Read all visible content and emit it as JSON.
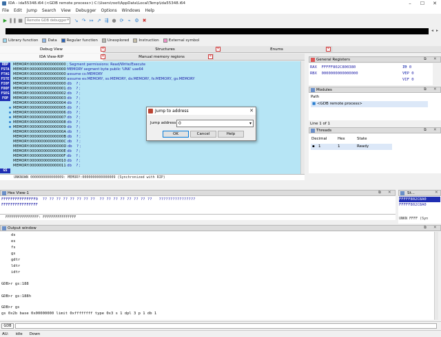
{
  "window": {
    "title": "IDA - ida55348.i64 (<GDB remote process>) C:\\Users\\root\\AppData\\Local\\Temp\\ida55348.i64",
    "min": "–",
    "max": "☐",
    "close": "✕"
  },
  "menu": [
    "File",
    "Edit",
    "Jump",
    "Search",
    "View",
    "Debugger",
    "Options",
    "Windows",
    "Help"
  ],
  "toolbar": {
    "debugger_select": "Remote GDB debugger"
  },
  "legend": [
    {
      "label": "Library function",
      "color": "#9ad8f0"
    },
    {
      "label": "Data",
      "color": "#8fb8e8"
    },
    {
      "label": "Regular function",
      "color": "#2a63b8"
    },
    {
      "label": "Unexplored",
      "color": "#b8b8b0"
    },
    {
      "label": "Instruction",
      "color": "#c8c0a8"
    },
    {
      "label": "External symbol",
      "color": "#f090c8"
    }
  ],
  "tabs": {
    "debug_view": "Debug View",
    "structures": "Structures",
    "enums": "Enums",
    "ida_view": "IDA View-RIP",
    "memory_regions": "Manual memory regions"
  },
  "registers_tags": [
    "RBP",
    "FSTA",
    "FTAG",
    "FSTE",
    "FIOF",
    "FOOF",
    "FSEG",
    "FOP"
  ],
  "code_lines": [
    {
      "addr": "MEMORY:0000000000000000",
      "text": " ; Segment permissions: Read/Write/Execute"
    },
    {
      "addr": "MEMORY:0000000000000000",
      "text": " MEMORY segment byte public 'UNK' use64"
    },
    {
      "addr": "MEMORY:0000000000000000",
      "text": " assume cs:MEMORY"
    },
    {
      "addr": "MEMORY:0000000000000000",
      "text": " assume es:MEMORY, ss:MEMORY, ds:MEMORY, fs:MEMORY, gs:MEMORY"
    },
    {
      "addr": "MEMORY:0000000000000000",
      "text": " db    ? ;"
    },
    {
      "addr": "MEMORY:0000000000000001",
      "text": " db    ? ;"
    },
    {
      "addr": "MEMORY:0000000000000002",
      "text": " db    ? ;"
    },
    {
      "addr": "MEMORY:0000000000000003",
      "text": " db    ? ;"
    },
    {
      "addr": "MEMORY:0000000000000004",
      "text": " db    ? ;"
    },
    {
      "addr": "MEMORY:0000000000000005",
      "text": " db    ? ;"
    },
    {
      "addr": "MEMORY:0000000000000006",
      "text": " db    ? ;"
    },
    {
      "addr": "MEMORY:0000000000000007",
      "text": " db    ? ;"
    },
    {
      "addr": "MEMORY:0000000000000008",
      "text": " db    ? ;"
    },
    {
      "addr": "MEMORY:0000000000000009",
      "text": " db    ? ;"
    },
    {
      "addr": "MEMORY:000000000000000A",
      "text": " db    ? ;"
    },
    {
      "addr": "MEMORY:000000000000000B",
      "text": " db    ? ;"
    },
    {
      "addr": "MEMORY:000000000000000C",
      "text": " db    ? ;"
    },
    {
      "addr": "MEMORY:000000000000000D",
      "text": " db    ? ;"
    },
    {
      "addr": "MEMORY:000000000000000E",
      "text": " db    ? ;"
    },
    {
      "addr": "MEMORY:000000000000000F",
      "text": " db    ? ;"
    },
    {
      "addr": "MEMORY:0000000000000010",
      "text": " db    ? ;"
    },
    {
      "addr": "MEMORY:0000000000000011",
      "text": " db    ? ;"
    }
  ],
  "gs_tag": "GS",
  "code_status": "UNKNOWN 0000000000000009: MEMORY:0000000000000009 (Synchronized with RIP)",
  "gen_regs": {
    "title": "General Registers",
    "rows": [
      {
        "name": "RAX",
        "value": "FFFFF802C800380"
      },
      {
        "name": "RBX",
        "value": "0000000000000000"
      }
    ],
    "flags": [
      "ID 0",
      "VIP 0",
      "VIF 0"
    ]
  },
  "modules": {
    "title": "Modules",
    "col": "Path",
    "row": "<GDB remote process>",
    "status": "Line 1 of 1"
  },
  "threads": {
    "title": "Threads",
    "cols": [
      "Decimal",
      "Hex",
      "State"
    ],
    "row": {
      "decimal": "1",
      "hex": "1",
      "state": "Ready"
    }
  },
  "hex_view": {
    "title": "Hex View-1",
    "line1_addr": "FFFFFFFFFFFFFFF0",
    "line1_bytes": "  ?? ?? ?? ?? ?? ?? ?? ??  ?? ?? ?? ?? ?? ?? ?? ??",
    "line1_ascii": "????????????????",
    "line2_addr": "FFFFFFFFFFFFFFFF",
    "status": "FFFFFFFFFFFFFFFF: FFFFFFFFFFFFFFFF"
  },
  "stack_view": {
    "title": "St...",
    "line1": "FFFFF802C8A0",
    "line2": "FFFFF802C8A0",
    "status": "UNKN FFFF (Syn"
  },
  "output": {
    "title": "Output window",
    "lines": [
      "ds",
      "es",
      "fs",
      "gs",
      "gdtr",
      "ldtr",
      "idtr"
    ],
    "gdb_lines": [
      "GDB>r gs:188",
      "",
      "GDB>r gs:188h",
      "",
      "GDB>r gs",
      "gs 0x2b base 0x00000000 limit 0xffffffff type 0x3 s 1 dpl 3 p 1 db 1"
    ]
  },
  "cmd": {
    "label": "GDB"
  },
  "status": {
    "au": "AU:",
    "state": "idle",
    "dir": "Down"
  },
  "dialog": {
    "title": "Jump to address",
    "label": "Jump address",
    "value": "0",
    "ok": "OK",
    "cancel": "Cancel",
    "help": "Help"
  }
}
